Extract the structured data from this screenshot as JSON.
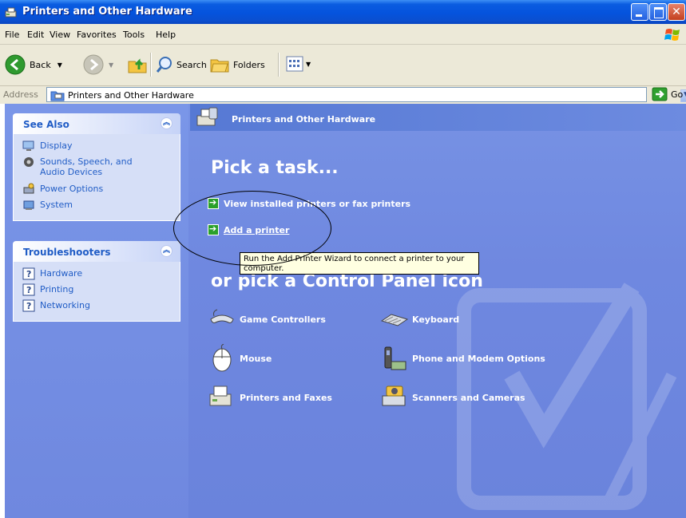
{
  "window": {
    "title": "Printers and Other Hardware"
  },
  "menu": [
    {
      "label": "File"
    },
    {
      "label": "Edit"
    },
    {
      "label": "View"
    },
    {
      "label": "Favorites"
    },
    {
      "label": "Tools"
    },
    {
      "label": "Help"
    }
  ],
  "toolbar": {
    "back": "Back",
    "search": "Search",
    "folders": "Folders"
  },
  "address": {
    "label": "Address",
    "value": "Printers and Other Hardware",
    "go": "Go"
  },
  "see_also": {
    "title": "See Also",
    "items": [
      {
        "label": "Display"
      },
      {
        "label": "Sounds, Speech, and Audio Devices"
      },
      {
        "label": "Power Options"
      },
      {
        "label": "System"
      }
    ]
  },
  "troubleshooters": {
    "title": "Troubleshooters",
    "items": [
      {
        "label": "Hardware"
      },
      {
        "label": "Printing"
      },
      {
        "label": "Networking"
      }
    ]
  },
  "main": {
    "banner_title": "Printers and Other Hardware",
    "pick_task": "Pick a task...",
    "tasks": [
      {
        "label": "View installed printers or fax printers"
      },
      {
        "label": "Add a printer"
      }
    ],
    "tooltip": "Run the Add Printer Wizard to connect a printer to your computer.",
    "pick_icon": "or pick a Control Panel icon",
    "icons": [
      {
        "label": "Game Controllers"
      },
      {
        "label": "Keyboard"
      },
      {
        "label": "Mouse"
      },
      {
        "label": "Phone and Modem Options"
      },
      {
        "label": "Printers and Faxes"
      },
      {
        "label": "Scanners and Cameras"
      }
    ]
  }
}
